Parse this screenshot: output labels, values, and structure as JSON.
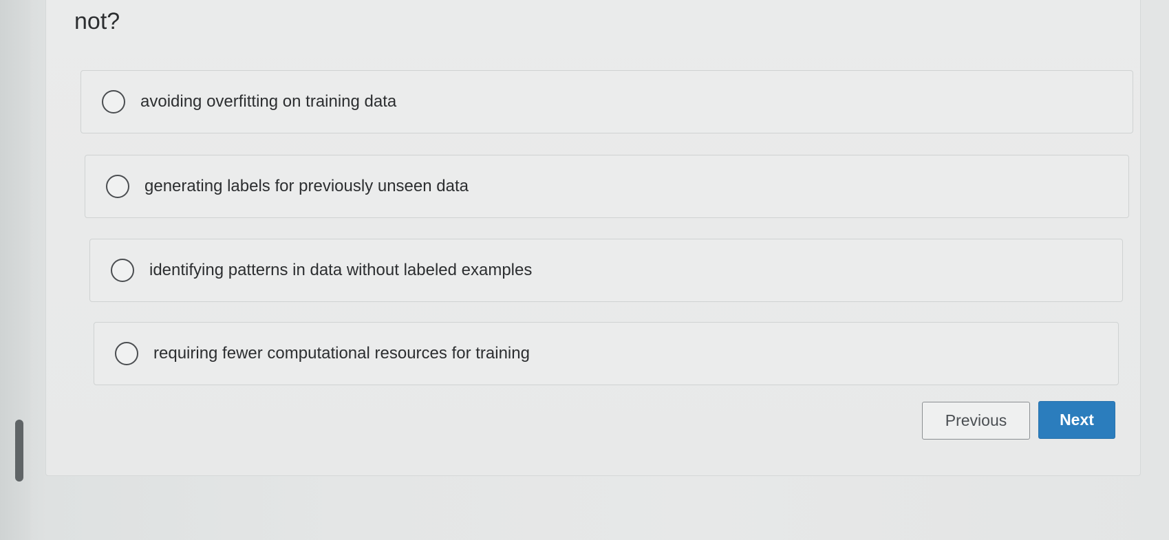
{
  "question": {
    "visible_text": "not?"
  },
  "options": [
    {
      "label": "avoiding overfitting on training data",
      "selected": false
    },
    {
      "label": "generating labels for previously unseen data",
      "selected": false
    },
    {
      "label": "identifying patterns in data without labeled examples",
      "selected": false
    },
    {
      "label": "requiring fewer computational resources for training",
      "selected": false
    }
  ],
  "navigation": {
    "previous_label": "Previous",
    "next_label": "Next"
  },
  "colors": {
    "next_button": "#2b7dbd",
    "background": "#e6e8e8"
  }
}
